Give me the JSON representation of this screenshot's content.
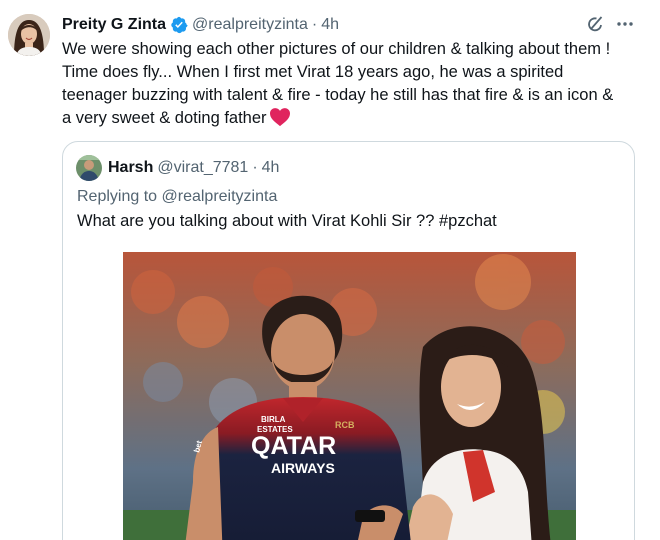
{
  "tweet": {
    "author": {
      "name": "Preity G Zinta",
      "handle": "@realpreityzinta",
      "verified": true
    },
    "separator": "·",
    "time": "4h",
    "text_lines": [
      "We were showing each other pictures of our children & talking about them !",
      "Time does fly... When I first met Virat 18 years ago, he was a spirited",
      "teenager buzzing with talent & fire - today he still has that fire & is an icon &",
      "a very sweet & doting father"
    ],
    "emoji": "red-heart",
    "actions": [
      "grok-icon",
      "more-icon"
    ]
  },
  "quoted": {
    "author": {
      "name": "Harsh",
      "handle": "@virat_7781"
    },
    "separator": "·",
    "time": "4h",
    "replying_prefix": "Replying to",
    "replying_to": "@realpreityzinta",
    "text": "What are you talking about with Virat Kohli Sir ?? #pzchat"
  },
  "media": {
    "jersey_sponsor_top": "BIRLA",
    "jersey_sponsor_bottom": "ESTATES",
    "jersey_main_top": "QATAR",
    "jersey_main_bottom": "AIRWAYS",
    "jersey_crest": "RCB",
    "jersey_side": "bet"
  },
  "colors": {
    "text_primary": "#0f1419",
    "text_secondary": "#536471",
    "border": "#cfd9de",
    "verified_blue": "#1d9bf0",
    "heart_red": "#e0245e"
  }
}
